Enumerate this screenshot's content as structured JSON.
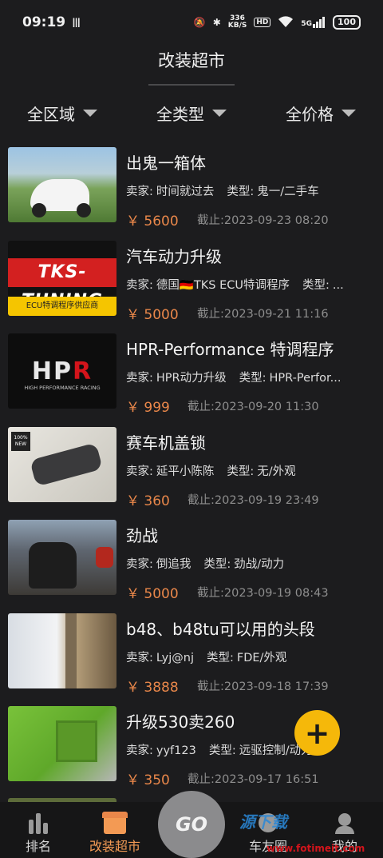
{
  "status_bar": {
    "time": "09:19",
    "carrier_glyph": "Ⅲ",
    "net_speed_value": "336",
    "net_speed_unit": "KB/S",
    "hd_badge": "HD",
    "signal": "5G",
    "battery": "100"
  },
  "header": {
    "title": "改装超市"
  },
  "filters": [
    {
      "label": "全区域"
    },
    {
      "label": "全类型"
    },
    {
      "label": "全价格"
    }
  ],
  "labels": {
    "seller": "卖家:",
    "type": "类型:",
    "deadline": "截止:"
  },
  "items": [
    {
      "title": "出鬼一箱体",
      "seller": "时间就过去",
      "type": "鬼一/二手车",
      "price": "￥ 5600",
      "deadline": "2023-09-23 08:20"
    },
    {
      "title": "汽车动力升级",
      "seller": "德国🇩🇪TKS ECU特调程序",
      "type": "...",
      "price": "￥ 5000",
      "deadline": "2023-09-21 11:16"
    },
    {
      "title": "HPR-Performance 特调程序",
      "seller": "HPR动力升级",
      "type": "HPR-Perfor...",
      "price": "￥ 999",
      "deadline": "2023-09-20 11:30"
    },
    {
      "title": "赛车机盖锁",
      "seller": "延平小陈陈",
      "type": "无/外观",
      "price": "￥ 360",
      "deadline": "2023-09-19 23:49"
    },
    {
      "title": "劲战",
      "seller": "倒追我",
      "type": "劲战/动力",
      "price": "￥ 5000",
      "deadline": "2023-09-19 08:43"
    },
    {
      "title": "b48、b48tu可以用的头段",
      "seller": "Lyj@nj",
      "type": "FDE/外观",
      "price": "￥ 3888",
      "deadline": "2023-09-18 17:39"
    },
    {
      "title": "升级530卖260",
      "seller": "yyf123",
      "type": "远驱控制/动力",
      "price": "￥ 350",
      "deadline": "2023-09-17 16:51"
    }
  ],
  "thumb_text": {
    "tks_logo": "TKS-TUNING",
    "tks_sub": "ECU特调程序供应商",
    "hpr_logo_a": "HP",
    "hpr_logo_b": "R",
    "hpr_sub": "HIGH PERFORMANCE RACING",
    "new_badge": "100% NEW"
  },
  "fab": {
    "label": "+"
  },
  "bottom_nav": [
    {
      "label": "排名",
      "icon": "bar-chart-icon"
    },
    {
      "label": "改装超市",
      "icon": "shop-icon",
      "active": true
    },
    {
      "label": "GO",
      "icon": "go-button"
    },
    {
      "label": "车友圈",
      "icon": "community-icon"
    },
    {
      "label": "我的",
      "icon": "profile-icon"
    }
  ],
  "watermark": {
    "main": "源下载",
    "url": "www.fotimeit.com"
  },
  "colors": {
    "accent": "#f39a54",
    "price": "#e9874a",
    "fab": "#f5b80a",
    "background": "#1c1c1e"
  }
}
